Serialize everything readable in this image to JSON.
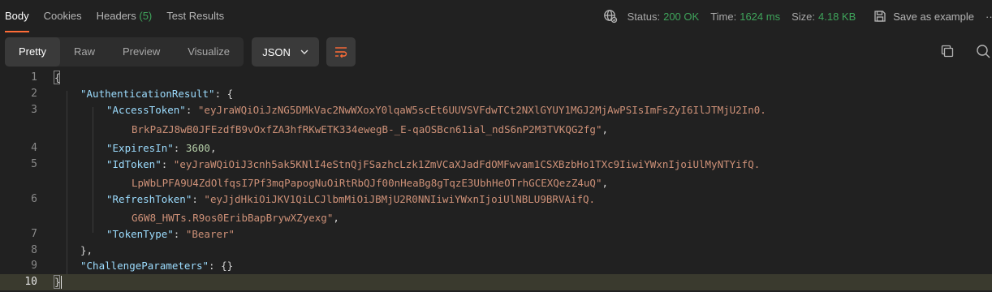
{
  "tabs": [
    {
      "label": "Body",
      "active": true
    },
    {
      "label": "Cookies"
    },
    {
      "label": "Headers",
      "count": "(5)"
    },
    {
      "label": "Test Results"
    }
  ],
  "meta": {
    "status_label": "Status:",
    "status_value": "200 OK",
    "time_label": "Time:",
    "time_value": "1624 ms",
    "size_label": "Size:",
    "size_value": "4.18 KB",
    "save_label": "Save as example",
    "more_label": "···"
  },
  "view_modes": [
    "Pretty",
    "Raw",
    "Preview",
    "Visualize"
  ],
  "active_view": "Pretty",
  "format": "JSON",
  "icons": {
    "network": "globe-icon",
    "save": "save-icon",
    "wrap": "wrap-lines-icon",
    "copy": "copy-icon",
    "search": "search-icon",
    "dropdown": "chevron-down-icon"
  },
  "colors": {
    "accent": "#ff6c37",
    "status_ok": "#3fa45b",
    "key": "#9cdcfe",
    "string": "#ce9178",
    "number": "#b5cea8"
  },
  "code": {
    "line_numbers": [
      "1",
      "2",
      "3",
      "4",
      "5",
      "6",
      "7",
      "8",
      "9",
      "10"
    ],
    "open_brace": "{",
    "auth_key": "\"AuthenticationResult\"",
    "auth_after": ": {",
    "access_key": "\"AccessToken\"",
    "access_val_1": "\"eyJraWQiOiJzNG5DMkVac2NwWXoxY0lqaW5scEt6UUVSVFdwTCt2NXlGYUY1MGJ2MjAwPSIsImFsZyI6IlJTMjU2In0.",
    "access_val_2": "BrkPaZJ8wB0JFEzdfB9vOxfZA3hfRKwETK334ewegB-_E-qaOSBcn61ial_ndS6nP2M3TVKQG2fg\"",
    "expires_key": "\"ExpiresIn\"",
    "expires_val": "3600",
    "id_key": "\"IdToken\"",
    "id_val_1": "\"eyJraWQiOiJ3cnh5ak5KNlI4eStnQjFSazhcLzk1ZmVCaXJadFdOMFwvam1CSXBzbHo1TXc9IiwiYWxnIjoiUlMyNTYifQ.",
    "id_val_2": "LpWbLPFA9U4ZdOlfqsI7Pf3mqPapogNuOiRtRbQJf00nHeaBg8gTqzE3UbhHeOTrhGCEXQezZ4uQ\"",
    "refresh_key": "\"RefreshToken\"",
    "refresh_val_1": "\"eyJjdHkiOiJKV1QiLCJlbmMiOiJBMjU2R0NNIiwiYWxnIjoiUlNBLU9BRVAifQ.",
    "refresh_val_2": "G6W8_HWTs.R9os0EribBapBrywXZyexg\"",
    "type_key": "\"TokenType\"",
    "type_val": "\"Bearer\"",
    "close_inner": "},",
    "challenge_key": "\"ChallengeParameters\"",
    "challenge_after": ": {}",
    "close_brace": "}"
  }
}
